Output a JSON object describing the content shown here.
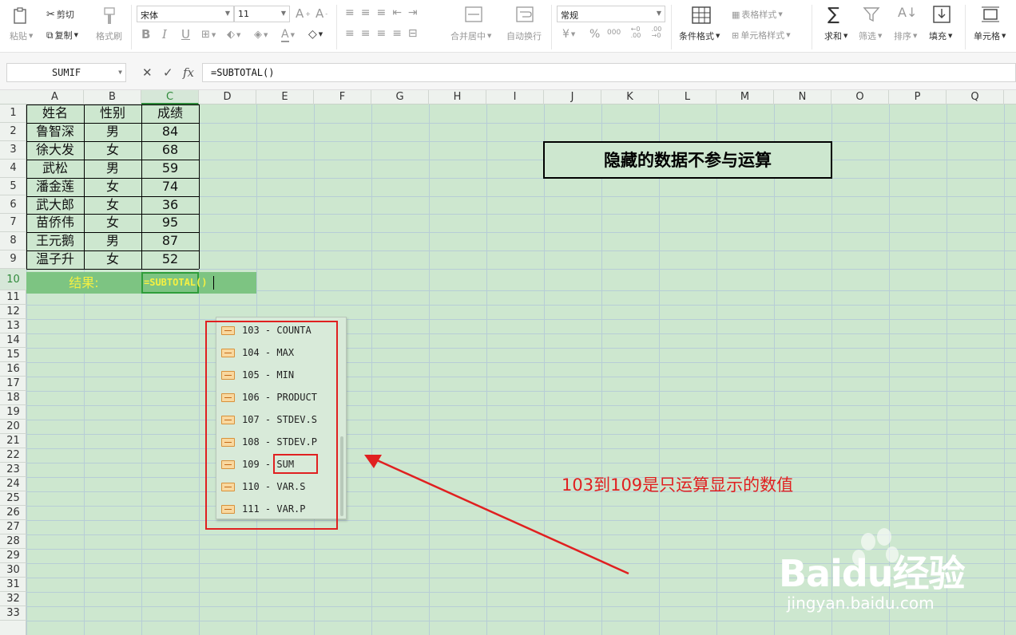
{
  "ribbon": {
    "paste": "粘贴",
    "cut": "剪切",
    "copy": "复制",
    "format_painter": "格式刷",
    "font_name": "宋体",
    "font_size": "11",
    "bold": "B",
    "italic": "I",
    "underline": "U",
    "merge_center": "合并居中",
    "wrap_text": "自动换行",
    "number_format": "常规",
    "currency": "¥",
    "percent": "%",
    "thousands": "000",
    "conditional_format": "条件格式",
    "table_style": "表格样式",
    "cell_style": "单元格样式",
    "sum": "求和",
    "filter": "筛选",
    "sort": "排序",
    "fill": "填充",
    "cell": "单元格"
  },
  "formula_bar": {
    "name_box": "SUMIF",
    "cancel": "✕",
    "confirm": "✓",
    "fx": "fx",
    "formula": "=SUBTOTAL()"
  },
  "columns": [
    "A",
    "B",
    "C",
    "D",
    "E",
    "F",
    "G",
    "H",
    "I",
    "J",
    "K",
    "L",
    "M",
    "N",
    "O",
    "P",
    "Q"
  ],
  "active_column": "C",
  "active_row": "10",
  "rows": [
    "1",
    "2",
    "3",
    "4",
    "5",
    "6",
    "7",
    "8",
    "9",
    "10",
    "11",
    "12",
    "13",
    "14",
    "15",
    "16",
    "17",
    "18",
    "19",
    "20",
    "21",
    "22",
    "23",
    "24",
    "25",
    "26",
    "27",
    "28",
    "29",
    "30",
    "31",
    "32",
    "33"
  ],
  "table": {
    "headers": [
      "姓名",
      "性别",
      "成绩"
    ],
    "rows": [
      [
        "鲁智深",
        "男",
        "84"
      ],
      [
        "徐大发",
        "女",
        "68"
      ],
      [
        "武松",
        "男",
        "59"
      ],
      [
        "潘金莲",
        "女",
        "74"
      ],
      [
        "武大郎",
        "女",
        "36"
      ],
      [
        "苗侨伟",
        "女",
        "95"
      ],
      [
        "王元鹅",
        "男",
        "87"
      ],
      [
        "温子升",
        "女",
        "52"
      ]
    ],
    "result_label": "结果:",
    "result_formula": "=SUBTOTAL()"
  },
  "callout": "隐藏的数据不参与运算",
  "autocomplete": [
    {
      "code": "103",
      "sep": " - ",
      "name": "COUNTA"
    },
    {
      "code": "104",
      "sep": " - ",
      "name": "MAX"
    },
    {
      "code": "105",
      "sep": " - ",
      "name": "MIN"
    },
    {
      "code": "106",
      "sep": " - ",
      "name": "PRODUCT"
    },
    {
      "code": "107",
      "sep": " - ",
      "name": "STDEV.S"
    },
    {
      "code": "108",
      "sep": " - ",
      "name": "STDEV.P"
    },
    {
      "code": "109",
      "sep": " - ",
      "name": "SUM"
    },
    {
      "code": "110",
      "sep": " - ",
      "name": "VAR.S"
    },
    {
      "code": "111",
      "sep": " - ",
      "name": "VAR.P"
    }
  ],
  "annotation": "103到109是只运算显示的数值",
  "watermark": {
    "brand": "Baidu经验",
    "url": "jingyan.baidu.com"
  },
  "colors": {
    "grid_bg": "#cde7cf",
    "result_bg": "#7dc482",
    "result_text": "#f5f042",
    "annotation": "#e02020",
    "active": "#2f8a3a"
  }
}
